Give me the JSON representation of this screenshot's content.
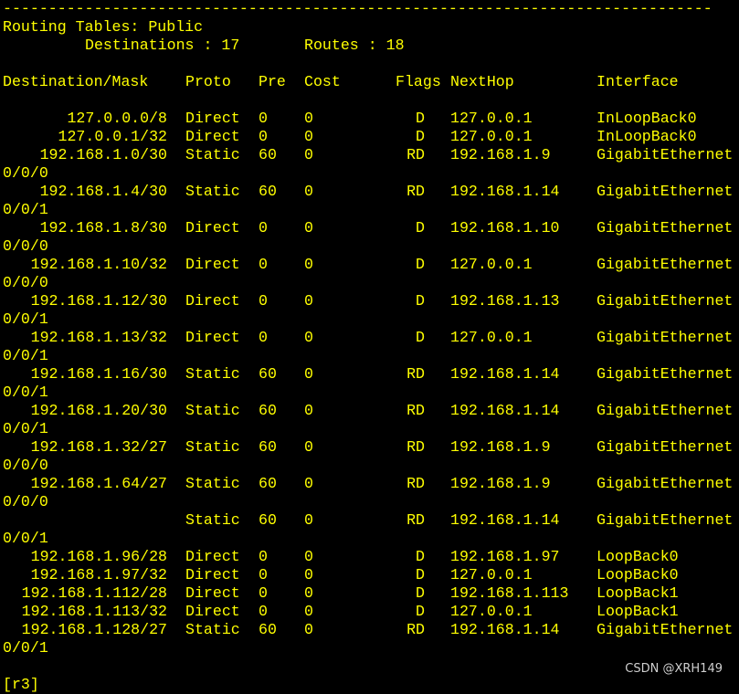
{
  "separator": "------------------------------------------------------------------------------",
  "header": {
    "title": "Routing Tables: Public",
    "destinations_label": "Destinations : 17",
    "routes_label": "Routes : 18"
  },
  "columns": {
    "destination": "Destination/Mask",
    "proto": "Proto",
    "pre": "Pre",
    "cost": "Cost",
    "flags": "Flags",
    "nexthop": "NextHop",
    "interface": "Interface"
  },
  "rows": [
    {
      "dest": "127.0.0.0/8",
      "proto": "Direct",
      "pre": "0",
      "cost": "0",
      "flags": "D",
      "nexthop": "127.0.0.1",
      "iface": "InLoopBack0",
      "iface2": ""
    },
    {
      "dest": "127.0.0.1/32",
      "proto": "Direct",
      "pre": "0",
      "cost": "0",
      "flags": "D",
      "nexthop": "127.0.0.1",
      "iface": "InLoopBack0",
      "iface2": ""
    },
    {
      "dest": "192.168.1.0/30",
      "proto": "Static",
      "pre": "60",
      "cost": "0",
      "flags": "RD",
      "nexthop": "192.168.1.9",
      "iface": "GigabitEthernet",
      "iface2": "0/0/0"
    },
    {
      "dest": "192.168.1.4/30",
      "proto": "Static",
      "pre": "60",
      "cost": "0",
      "flags": "RD",
      "nexthop": "192.168.1.14",
      "iface": "GigabitEthernet",
      "iface2": "0/0/1"
    },
    {
      "dest": "192.168.1.8/30",
      "proto": "Direct",
      "pre": "0",
      "cost": "0",
      "flags": "D",
      "nexthop": "192.168.1.10",
      "iface": "GigabitEthernet",
      "iface2": "0/0/0"
    },
    {
      "dest": "192.168.1.10/32",
      "proto": "Direct",
      "pre": "0",
      "cost": "0",
      "flags": "D",
      "nexthop": "127.0.0.1",
      "iface": "GigabitEthernet",
      "iface2": "0/0/0"
    },
    {
      "dest": "192.168.1.12/30",
      "proto": "Direct",
      "pre": "0",
      "cost": "0",
      "flags": "D",
      "nexthop": "192.168.1.13",
      "iface": "GigabitEthernet",
      "iface2": "0/0/1"
    },
    {
      "dest": "192.168.1.13/32",
      "proto": "Direct",
      "pre": "0",
      "cost": "0",
      "flags": "D",
      "nexthop": "127.0.0.1",
      "iface": "GigabitEthernet",
      "iface2": "0/0/1"
    },
    {
      "dest": "192.168.1.16/30",
      "proto": "Static",
      "pre": "60",
      "cost": "0",
      "flags": "RD",
      "nexthop": "192.168.1.14",
      "iface": "GigabitEthernet",
      "iface2": "0/0/1"
    },
    {
      "dest": "192.168.1.20/30",
      "proto": "Static",
      "pre": "60",
      "cost": "0",
      "flags": "RD",
      "nexthop": "192.168.1.14",
      "iface": "GigabitEthernet",
      "iface2": "0/0/1"
    },
    {
      "dest": "192.168.1.32/27",
      "proto": "Static",
      "pre": "60",
      "cost": "0",
      "flags": "RD",
      "nexthop": "192.168.1.9",
      "iface": "GigabitEthernet",
      "iface2": "0/0/0"
    },
    {
      "dest": "192.168.1.64/27",
      "proto": "Static",
      "pre": "60",
      "cost": "0",
      "flags": "RD",
      "nexthop": "192.168.1.9",
      "iface": "GigabitEthernet",
      "iface2": "0/0/0"
    },
    {
      "dest": "",
      "proto": "Static",
      "pre": "60",
      "cost": "0",
      "flags": "RD",
      "nexthop": "192.168.1.14",
      "iface": "GigabitEthernet",
      "iface2": "0/0/1"
    },
    {
      "dest": "192.168.1.96/28",
      "proto": "Direct",
      "pre": "0",
      "cost": "0",
      "flags": "D",
      "nexthop": "192.168.1.97",
      "iface": "LoopBack0",
      "iface2": ""
    },
    {
      "dest": "192.168.1.97/32",
      "proto": "Direct",
      "pre": "0",
      "cost": "0",
      "flags": "D",
      "nexthop": "127.0.0.1",
      "iface": "LoopBack0",
      "iface2": ""
    },
    {
      "dest": "192.168.1.112/28",
      "proto": "Direct",
      "pre": "0",
      "cost": "0",
      "flags": "D",
      "nexthop": "192.168.1.113",
      "iface": "LoopBack1",
      "iface2": ""
    },
    {
      "dest": "192.168.1.113/32",
      "proto": "Direct",
      "pre": "0",
      "cost": "0",
      "flags": "D",
      "nexthop": "127.0.0.1",
      "iface": "LoopBack1",
      "iface2": ""
    },
    {
      "dest": "192.168.1.128/27",
      "proto": "Static",
      "pre": "60",
      "cost": "0",
      "flags": "RD",
      "nexthop": "192.168.1.14",
      "iface": "GigabitEthernet",
      "iface2": "0/0/1"
    }
  ],
  "prompt": "[r3]",
  "watermark": "CSDN @XRH149",
  "colors": {
    "background": "#000000",
    "text": "#ffff00"
  }
}
